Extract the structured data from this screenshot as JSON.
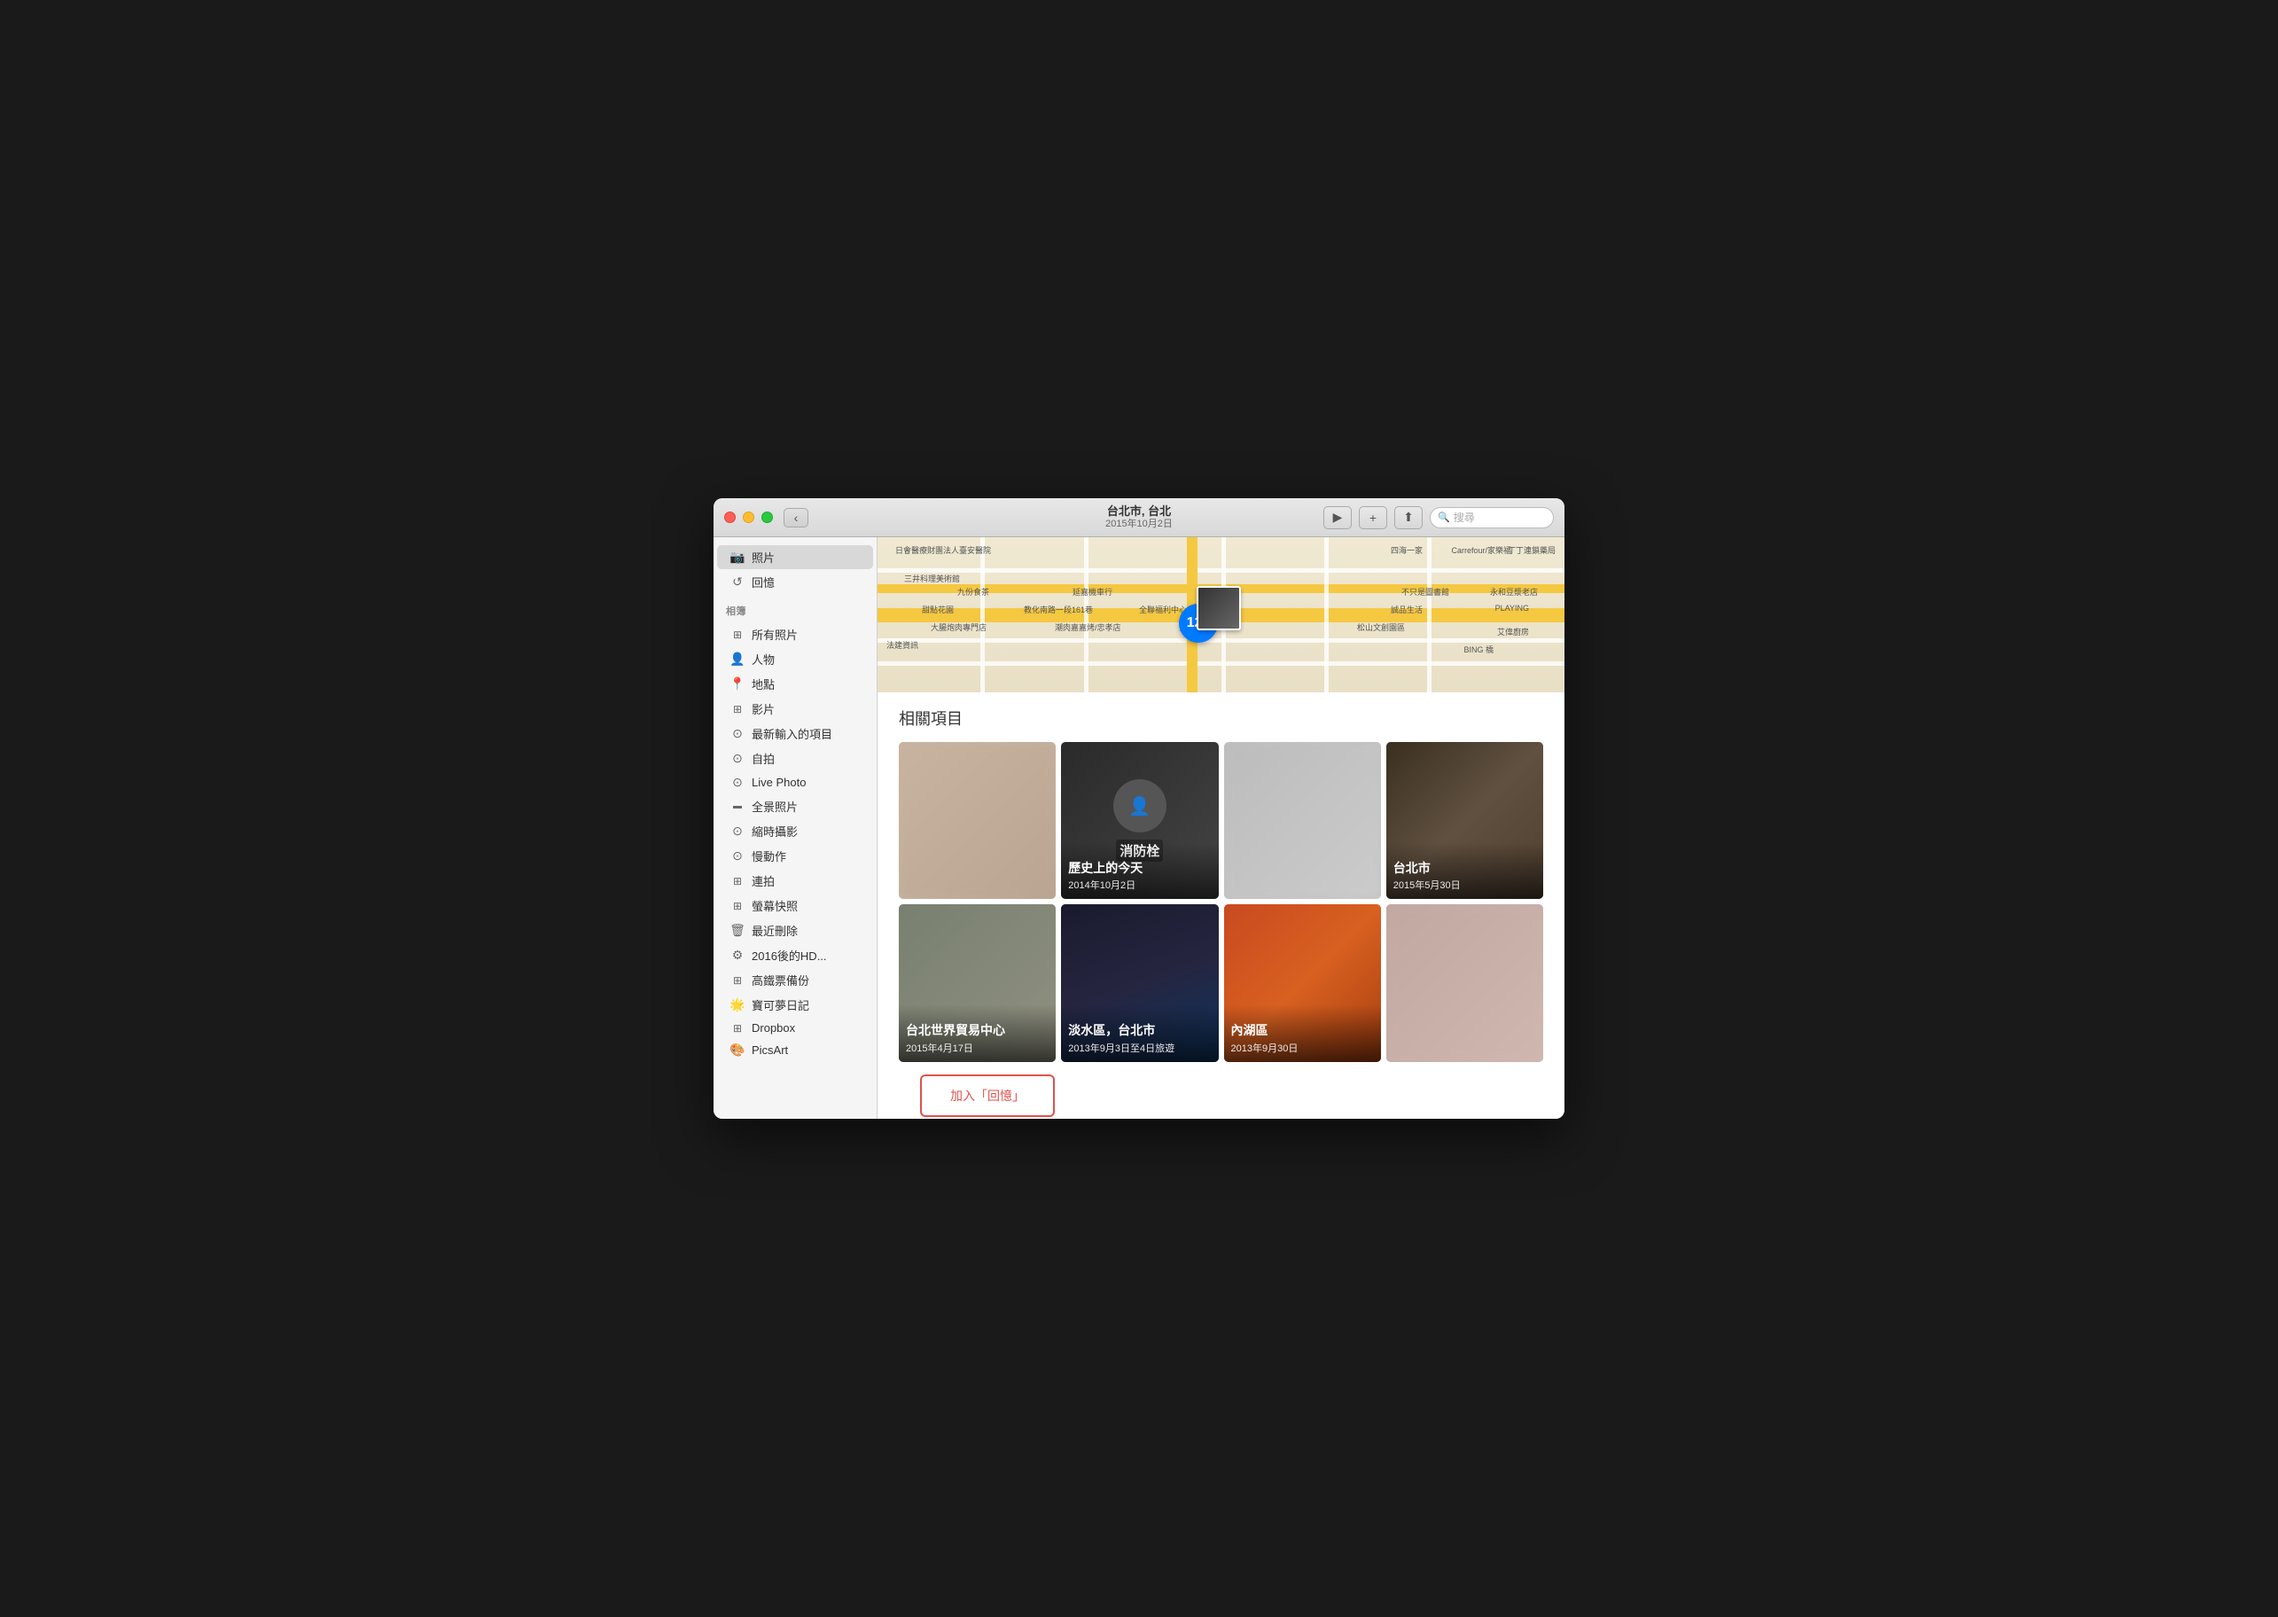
{
  "window": {
    "title": "台北市, 台北",
    "subtitle": "2015年10月2日"
  },
  "titlebar": {
    "back_label": "‹",
    "play_icon": "▶",
    "add_icon": "+",
    "share_icon": "⬆",
    "search_placeholder": "搜尋"
  },
  "sidebar": {
    "top_items": [
      {
        "id": "photos",
        "icon": "📷",
        "label": "照片",
        "active": true
      },
      {
        "id": "memories",
        "icon": "⟳",
        "label": "回憶",
        "active": false
      }
    ],
    "section_label": "相簿",
    "items": [
      {
        "id": "all-photos",
        "icon": "▦",
        "label": "所有照片"
      },
      {
        "id": "people",
        "icon": "👤",
        "label": "人物"
      },
      {
        "id": "places",
        "icon": "📍",
        "label": "地點"
      },
      {
        "id": "videos",
        "icon": "▦",
        "label": "影片"
      },
      {
        "id": "imports",
        "icon": "⊙",
        "label": "最新輸入的項目"
      },
      {
        "id": "selfies",
        "icon": "⊙",
        "label": "自拍"
      },
      {
        "id": "live-photo",
        "icon": "⊙",
        "label": "Live Photo"
      },
      {
        "id": "panoramas",
        "icon": "▬",
        "label": "全景照片"
      },
      {
        "id": "timelapse",
        "icon": "⊙",
        "label": "縮時攝影"
      },
      {
        "id": "slo-mo",
        "icon": "⊙",
        "label": "慢動作"
      },
      {
        "id": "burst",
        "icon": "▦",
        "label": "連拍"
      },
      {
        "id": "screenshots",
        "icon": "▦",
        "label": "螢幕快照"
      },
      {
        "id": "recently-deleted",
        "icon": "🗑",
        "label": "最近刪除"
      },
      {
        "id": "hd2016",
        "icon": "⚙",
        "label": "2016後的HD..."
      },
      {
        "id": "train-tickets",
        "icon": "▦",
        "label": "高鐵票備份"
      },
      {
        "id": "pokemon",
        "icon": "🌟",
        "label": "寶可夢日記"
      },
      {
        "id": "dropbox",
        "icon": "▦",
        "label": "Dropbox"
      },
      {
        "id": "picsart",
        "icon": "🎨",
        "label": "PicsArt"
      }
    ]
  },
  "content": {
    "related_title": "相關項目",
    "grid_items": [
      {
        "id": "item1",
        "title": "",
        "subtitle": "",
        "color": "blurred",
        "show_overlay": false
      },
      {
        "id": "item2",
        "title": "歷史上的今天",
        "subtitle": "2014年10月2日",
        "color": "dark",
        "show_overlay": true
      },
      {
        "id": "item3",
        "title": "",
        "subtitle": "",
        "color": "bright",
        "show_overlay": false
      },
      {
        "id": "item4",
        "title": "台北市",
        "subtitle": "2015年5月30日",
        "color": "indoor",
        "show_overlay": true
      },
      {
        "id": "item5",
        "title": "台北世界貿易中心",
        "subtitle": "2015年4月17日",
        "color": "street",
        "show_overlay": true
      },
      {
        "id": "item6",
        "title": "淡水區，台北市",
        "subtitle": "2013年9月3日至4日旅遊",
        "color": "night",
        "show_overlay": true
      },
      {
        "id": "item7",
        "title": "內湖區",
        "subtitle": "2013年9月30日",
        "color": "event",
        "show_overlay": true
      },
      {
        "id": "item8",
        "title": "",
        "subtitle": "",
        "color": "blurred2",
        "show_overlay": false
      }
    ],
    "add_memories_label": "加入「回憶」"
  },
  "map": {
    "badge_count": "122",
    "location_label": "台北市, 台北"
  }
}
